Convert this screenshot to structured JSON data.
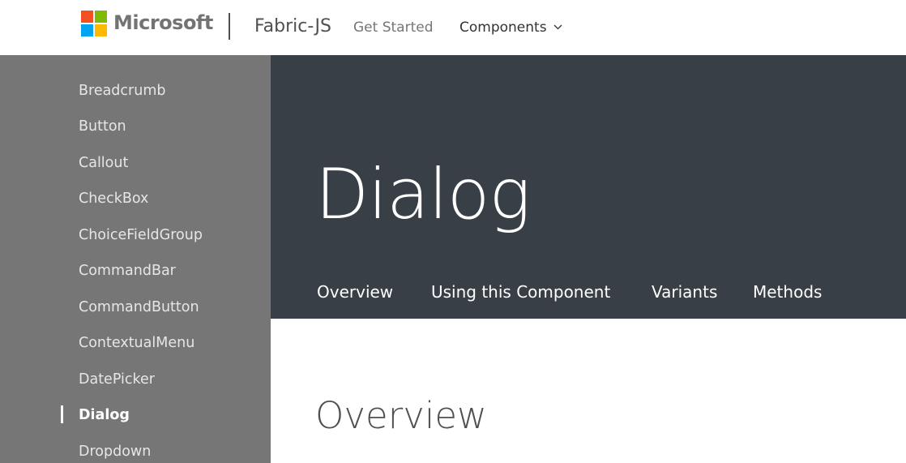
{
  "header": {
    "brand": "Microsoft",
    "site_title": "Fabric-JS",
    "nav": {
      "get_started": "Get Started",
      "components": "Components"
    },
    "icons": {
      "logo": "microsoft-logo-icon",
      "components_dropdown": "chevron-down-icon"
    }
  },
  "sidebar": {
    "items": [
      {
        "label": "Breadcrumb"
      },
      {
        "label": "Button"
      },
      {
        "label": "Callout"
      },
      {
        "label": "CheckBox"
      },
      {
        "label": "ChoiceFieldGroup"
      },
      {
        "label": "CommandBar"
      },
      {
        "label": "CommandButton"
      },
      {
        "label": "ContextualMenu"
      },
      {
        "label": "DatePicker"
      },
      {
        "label": "Dialog",
        "active": true
      },
      {
        "label": "Dropdown"
      }
    ]
  },
  "hero": {
    "title": "Dialog",
    "tabs": [
      {
        "label": "Overview"
      },
      {
        "label": "Using this Component"
      },
      {
        "label": "Variants"
      },
      {
        "label": "Methods"
      }
    ]
  },
  "content": {
    "section_heading": "Overview"
  },
  "colors": {
    "sidebar_bg": "#767676",
    "hero_bg": "#393f46",
    "logo_red": "#f25022",
    "logo_green": "#7fba00",
    "logo_blue": "#00a4ef",
    "logo_yellow": "#ffb900"
  }
}
